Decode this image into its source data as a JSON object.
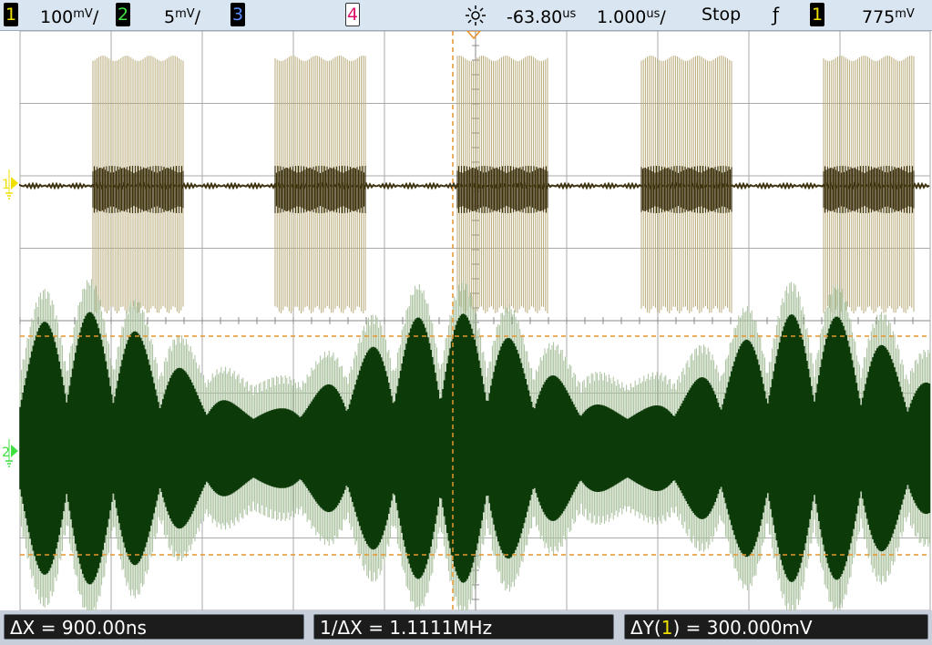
{
  "status_bar": {
    "ch1_label": "1",
    "ch1_scale": "100",
    "ch2_label": "2",
    "ch2_scale": "5",
    "ch3_label": "3",
    "ch4_label": "4",
    "trigger_icon": "sun-trigger-icon",
    "time_offset": "-63.80",
    "timebase": "1.000",
    "run_state": "Stop",
    "trigger_slope": "ƒ",
    "trigger_source": "1",
    "trigger_level": "775"
  },
  "markers": {
    "ch1_marker": "1",
    "ch2_marker": "2"
  },
  "measurements": {
    "delta_x": "ΔX = 900.00ns",
    "inv_delta_x": "1/ΔX = 1.1111MHz",
    "delta_y_prefix": "ΔY(",
    "delta_y_channel": "1",
    "delta_y_suffix": ") = 300.000mV"
  },
  "colors": {
    "ch1": "#f0e000",
    "ch1_trace_dark": "#3d3210",
    "ch1_trace_light": "#b8aa78",
    "ch2": "#40e040",
    "ch2_trace_dark": "#0c3a08",
    "ch2_trace_light": "#a8c09c",
    "ch3": "#5a8cff",
    "ch4": "#e0106a",
    "cursor": "#e8942a",
    "grid": "#aaaaaa"
  }
}
